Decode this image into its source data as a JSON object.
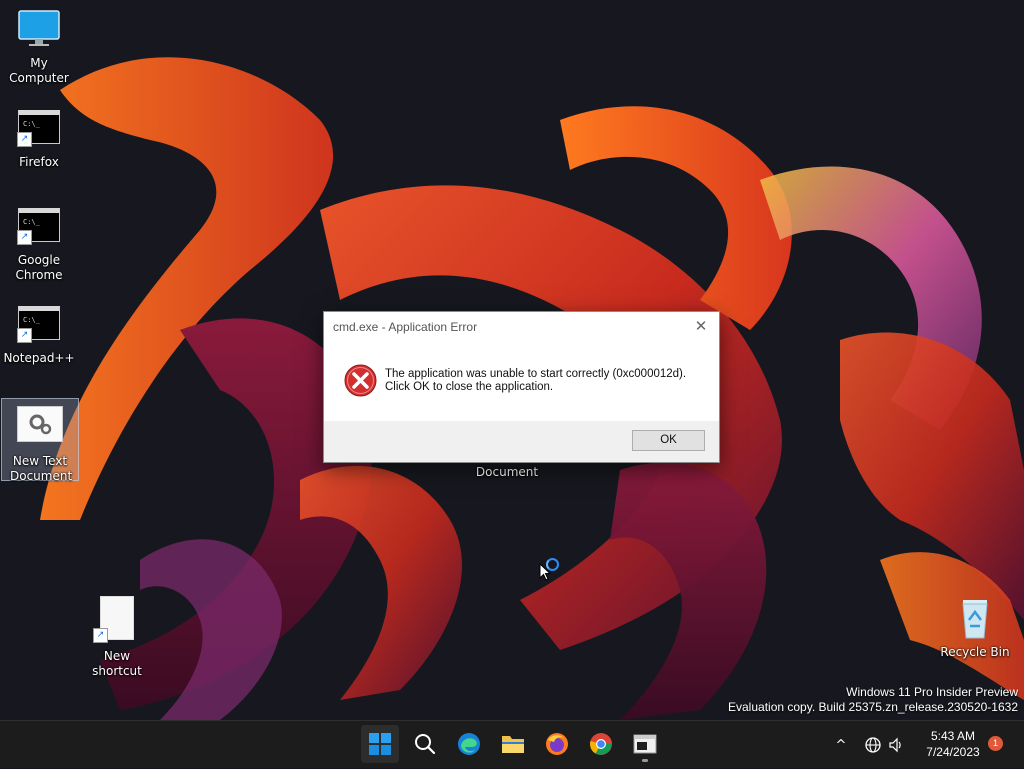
{
  "desktop": {
    "icons": [
      {
        "label": "My Computer"
      },
      {
        "label": "Firefox"
      },
      {
        "label": "Google Chrome"
      },
      {
        "label": "Notepad++"
      },
      {
        "label": "New Text Document"
      },
      {
        "label": "New shortcut"
      },
      {
        "label": "Recycle Bin"
      }
    ],
    "occluded_label": "Document",
    "cmd_prompt_glyph": "C:\\_"
  },
  "dialog": {
    "title": "cmd.exe - Application Error",
    "message_line1": "The application was unable to start correctly (0xc000012d).",
    "message_line2": "Click OK to close the application.",
    "ok_label": "OK",
    "close_glyph": "✕",
    "icon": "error-icon"
  },
  "watermark": {
    "line1": "Windows 11 Pro Insider Preview",
    "line2": "Evaluation copy. Build 25375.zn_release.230520-1632"
  },
  "taskbar": {
    "apps": [
      "start-icon",
      "search-icon",
      "edge-icon",
      "file-explorer-icon",
      "firefox-icon",
      "chrome-icon",
      "terminal-icon"
    ],
    "clock_time": "5:43 AM",
    "clock_date": "7/24/2023",
    "notification_count": "1",
    "tray_chevron": "^"
  },
  "colors": {
    "accent": "#0078d4",
    "error_red": "#d32f2f",
    "taskbar_bg": "#1c1c1c"
  }
}
